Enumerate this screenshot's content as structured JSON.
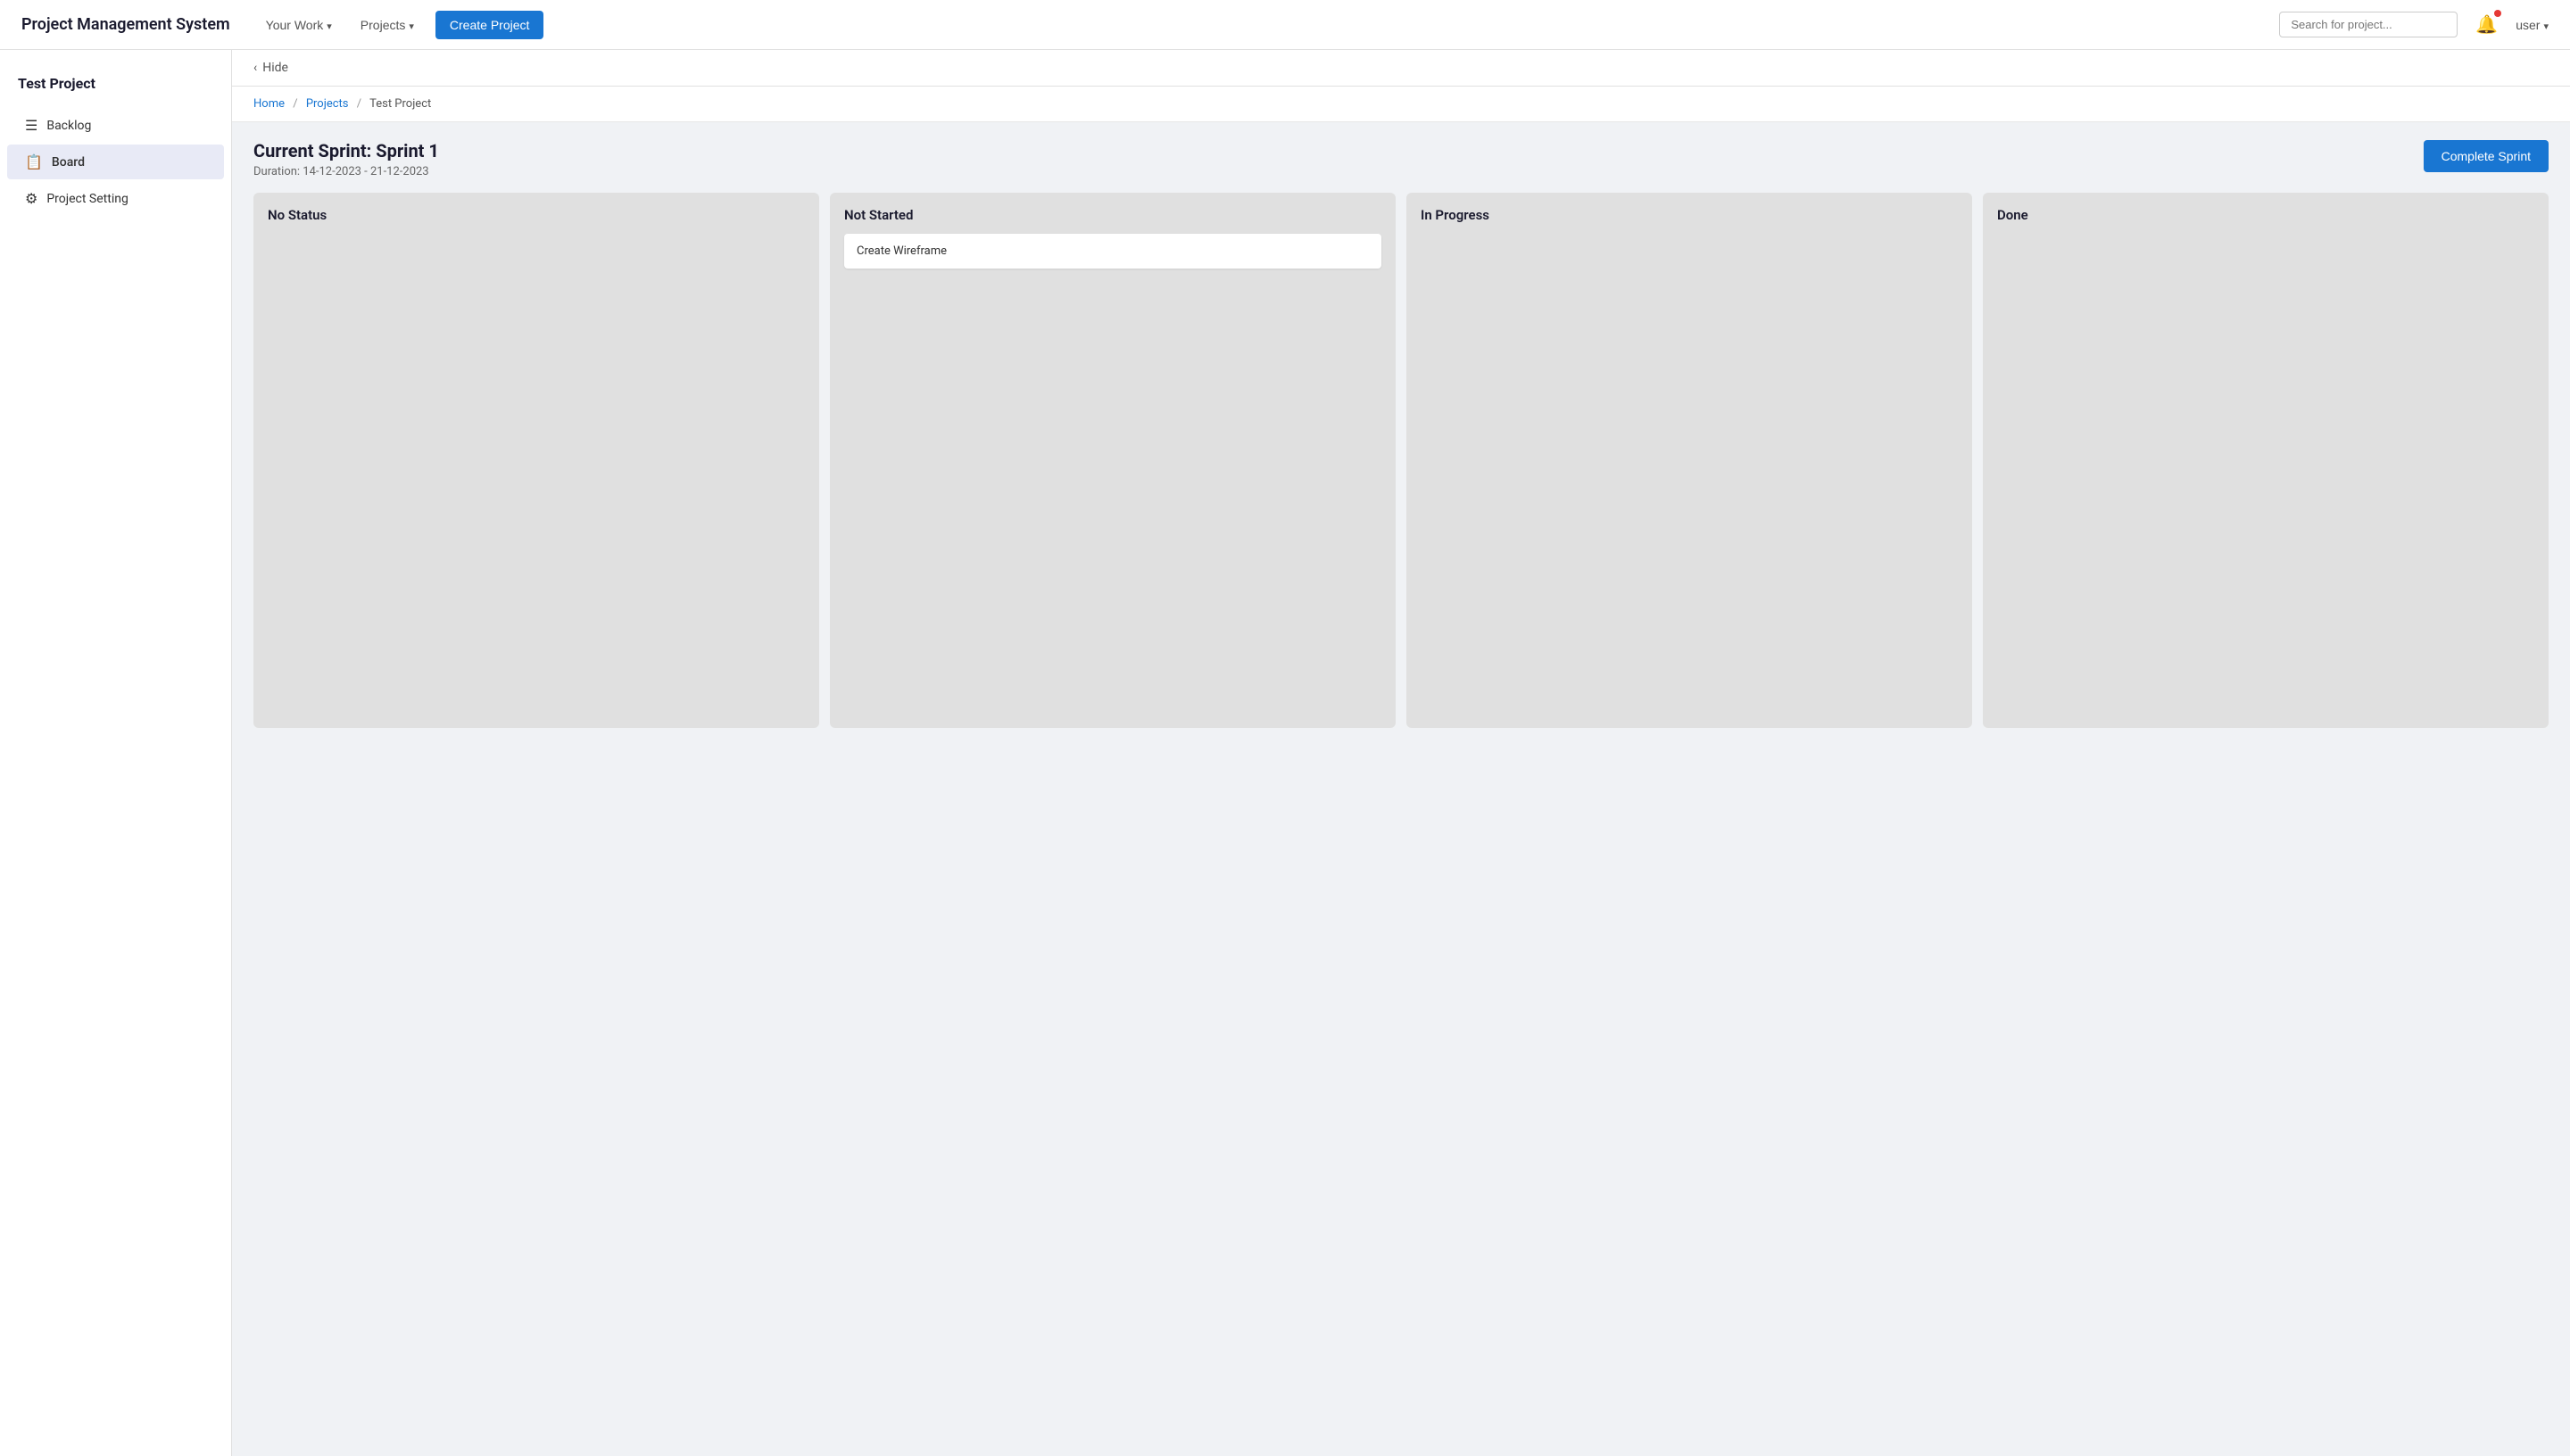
{
  "navbar": {
    "brand": "Project Management System",
    "your_work_label": "Your Work",
    "projects_label": "Projects",
    "create_project_label": "Create Project",
    "search_placeholder": "Search for project...",
    "user_label": "user"
  },
  "sidebar": {
    "project_title": "Test Project",
    "items": [
      {
        "id": "backlog",
        "label": "Backlog",
        "icon": "≡"
      },
      {
        "id": "board",
        "label": "Board",
        "icon": "📋"
      },
      {
        "id": "project-setting",
        "label": "Project Setting",
        "icon": "⚙"
      }
    ]
  },
  "hide_bar": {
    "icon": "‹",
    "label": "Hide"
  },
  "breadcrumb": {
    "home": "Home",
    "projects": "Projects",
    "current": "Test Project"
  },
  "sprint": {
    "title": "Current Sprint: Sprint 1",
    "duration": "Duration: 14-12-2023 - 21-12-2023",
    "complete_btn": "Complete Sprint"
  },
  "board": {
    "columns": [
      {
        "id": "no-status",
        "title": "No Status",
        "tasks": []
      },
      {
        "id": "not-started",
        "title": "Not Started",
        "tasks": [
          {
            "id": "task-1",
            "label": "Create Wireframe"
          }
        ]
      },
      {
        "id": "in-progress",
        "title": "In Progress",
        "tasks": []
      },
      {
        "id": "done",
        "title": "Done",
        "tasks": []
      }
    ]
  }
}
